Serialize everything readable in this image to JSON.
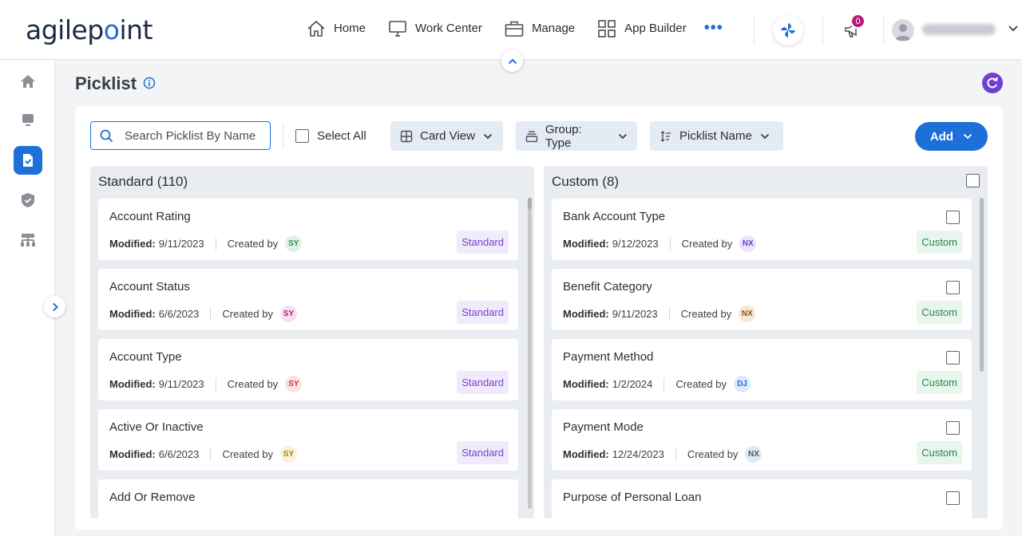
{
  "app": {
    "logo_text_a": "agilep",
    "logo_text_o": "o",
    "logo_text_b": "int"
  },
  "nav": {
    "items": [
      {
        "label": "Home",
        "icon": "home-icon"
      },
      {
        "label": "Work Center",
        "icon": "monitor-icon"
      },
      {
        "label": "Manage",
        "icon": "briefcase-icon"
      },
      {
        "label": "App Builder",
        "icon": "grid-icon"
      }
    ],
    "more_label": "•••",
    "notification_count": "0"
  },
  "sidebar": {
    "items": [
      {
        "name": "home",
        "icon": "home-icon",
        "active": false
      },
      {
        "name": "work-center",
        "icon": "monitor-icon",
        "active": false
      },
      {
        "name": "picklist",
        "icon": "clipboard-check-icon",
        "active": true
      },
      {
        "name": "security",
        "icon": "shield-icon",
        "active": false
      },
      {
        "name": "org-chart",
        "icon": "org-chart-icon",
        "active": false
      }
    ]
  },
  "page": {
    "title": "Picklist"
  },
  "toolbar": {
    "search_placeholder": "Search Picklist By Name",
    "select_all_label": "Select All",
    "view_label": "Card View",
    "group_label": "Group: Type",
    "sort_label": "Picklist Name",
    "add_label": "Add"
  },
  "columns": {
    "standard": {
      "title": "Standard (110)",
      "cards": [
        {
          "name": "Account Rating",
          "modified_label": "Modified:",
          "modified": "9/11/2023",
          "created_label": "Created by",
          "initials": "SY",
          "tag": "Standard"
        },
        {
          "name": "Account Status",
          "modified_label": "Modified:",
          "modified": "6/6/2023",
          "created_label": "Created by",
          "initials": "SY",
          "tag": "Standard"
        },
        {
          "name": "Account Type",
          "modified_label": "Modified:",
          "modified": "9/11/2023",
          "created_label": "Created by",
          "initials": "SY",
          "tag": "Standard"
        },
        {
          "name": "Active Or Inactive",
          "modified_label": "Modified:",
          "modified": "6/6/2023",
          "created_label": "Created by",
          "initials": "SY",
          "tag": "Standard"
        },
        {
          "name": "Add Or Remove"
        }
      ]
    },
    "custom": {
      "title": "Custom (8)",
      "cards": [
        {
          "name": "Bank Account Type",
          "modified_label": "Modified:",
          "modified": "9/12/2023",
          "created_label": "Created by",
          "initials": "NX",
          "tag": "Custom"
        },
        {
          "name": "Benefit Category",
          "modified_label": "Modified:",
          "modified": "9/11/2023",
          "created_label": "Created by",
          "initials": "NX",
          "tag": "Custom"
        },
        {
          "name": "Payment Method",
          "modified_label": "Modified:",
          "modified": "1/2/2024",
          "created_label": "Created by",
          "initials": "DJ",
          "tag": "Custom"
        },
        {
          "name": "Payment Mode",
          "modified_label": "Modified:",
          "modified": "12/24/2023",
          "created_label": "Created by",
          "initials": "NX",
          "tag": "Custom"
        },
        {
          "name": "Purpose of Personal Loan"
        }
      ]
    }
  },
  "colors": {
    "accent": "#1e6fd9",
    "standard_tag_text": "#7a3fd1",
    "custom_tag_text": "#1d8a4a",
    "badge": "#b5197a",
    "refresh": "#6f3fd6"
  }
}
